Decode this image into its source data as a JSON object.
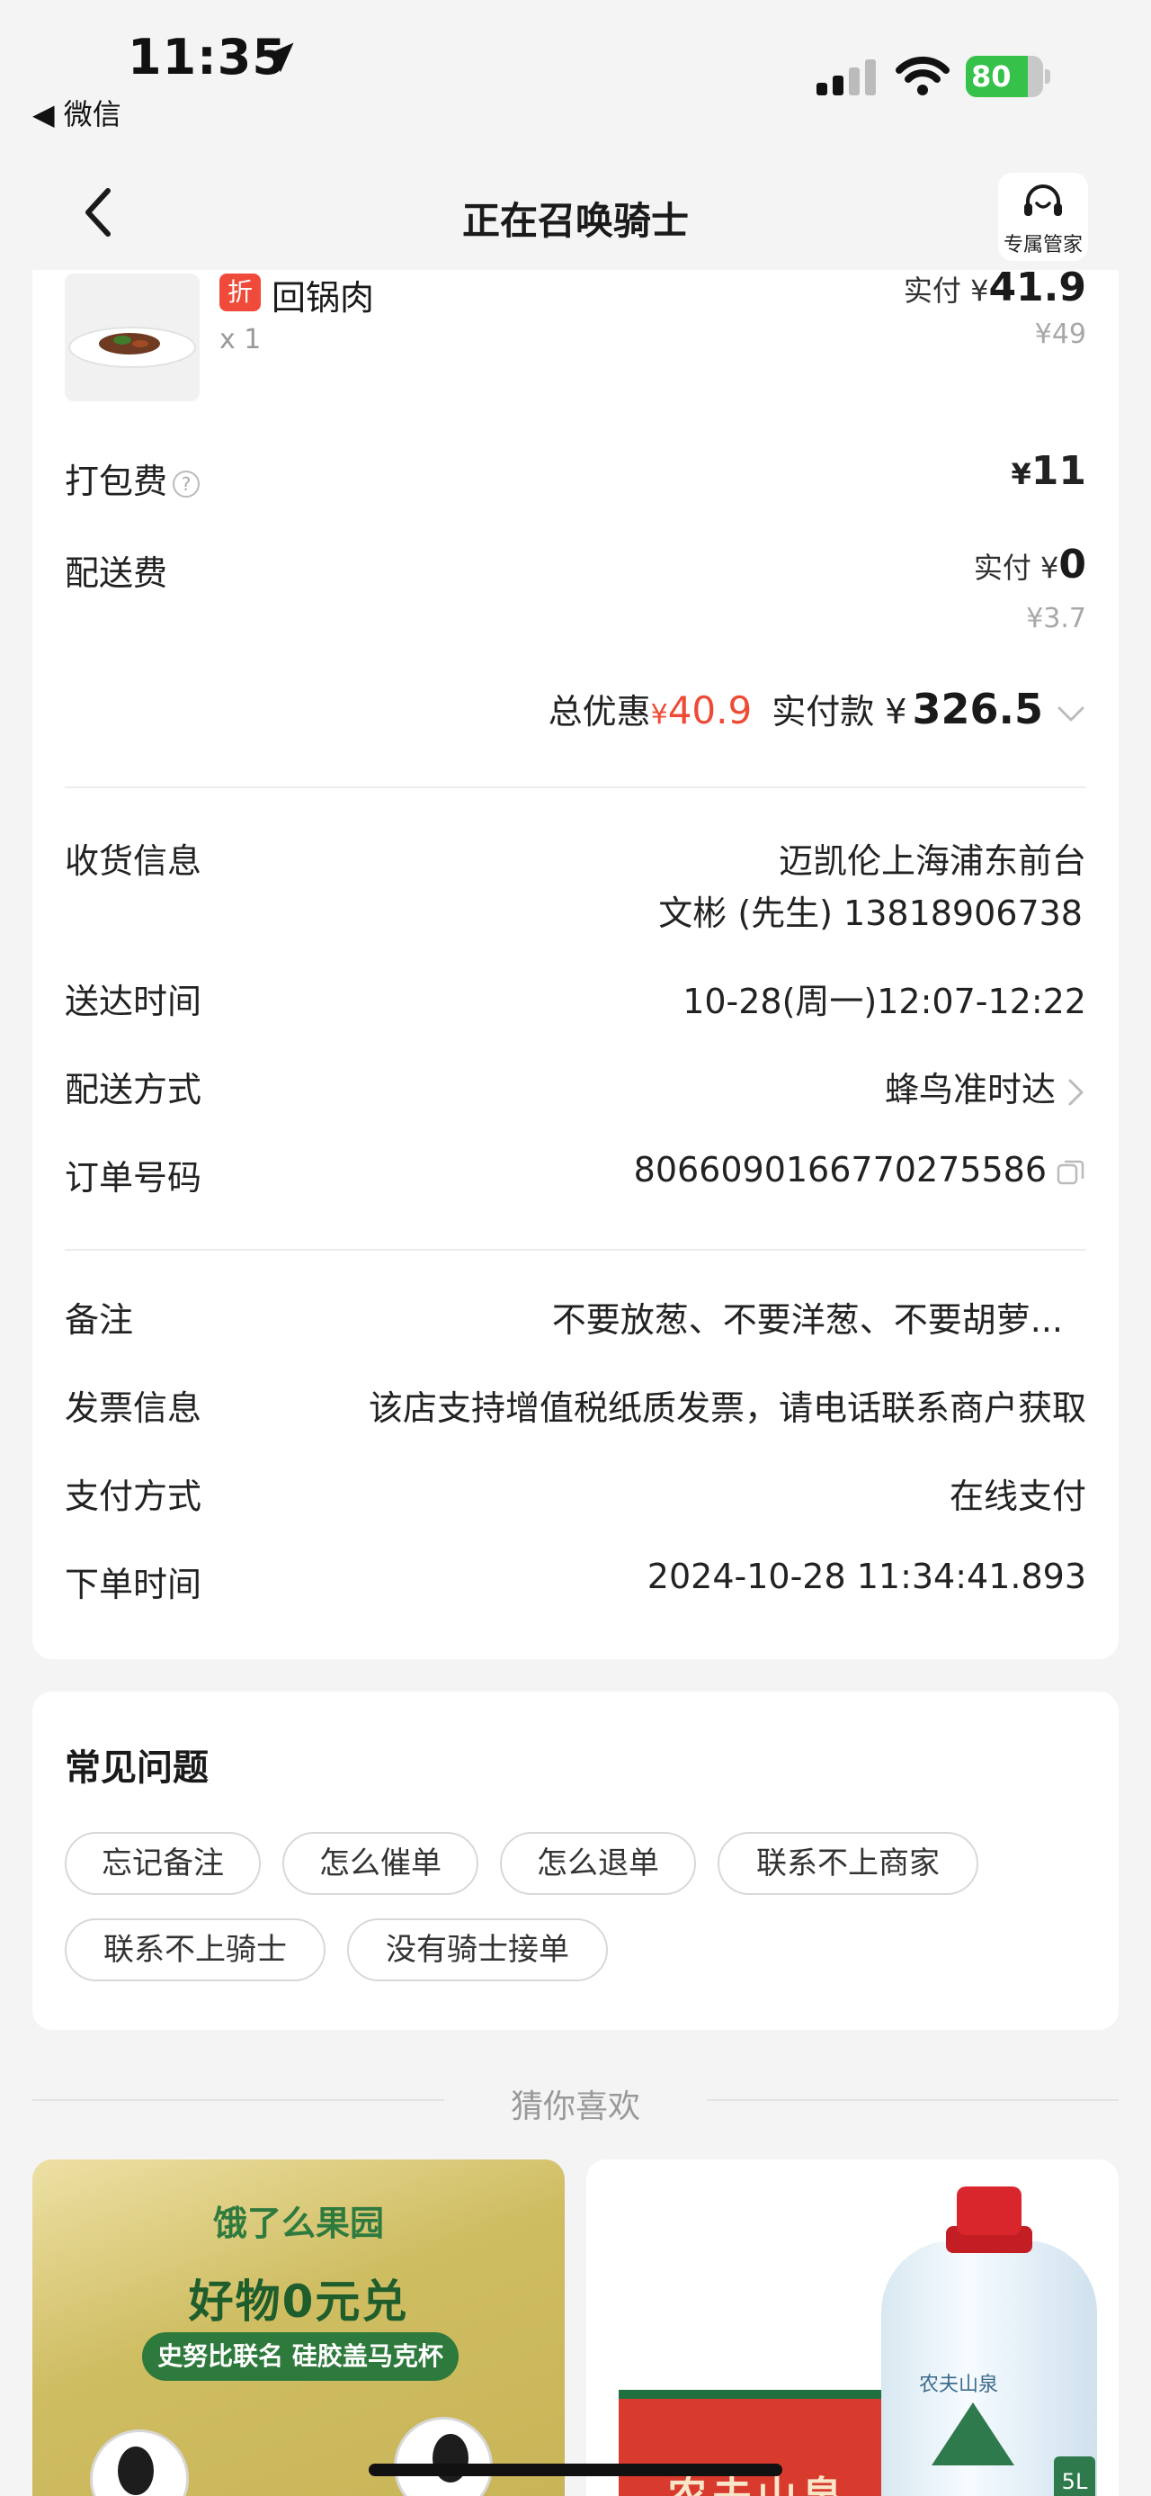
{
  "status_bar": {
    "time": "11:35",
    "back_app": "◀ 微信",
    "battery": "80",
    "battery_level": 0.8,
    "battery_color": "#36c24a"
  },
  "header": {
    "title": "正在召唤骑士",
    "agent_label": "专属管家"
  },
  "order_item": {
    "badge": "折",
    "name": "回锅肉",
    "qty": "x 1",
    "paid_label": "实付 ¥",
    "paid_value": "41.9",
    "original_price": "¥49"
  },
  "fees": {
    "packing_label": "打包费",
    "packing_info_icon": "?",
    "packing_currency": "¥",
    "packing_value": "11",
    "delivery_label": "配送费",
    "delivery_paid_label": "实付 ¥",
    "delivery_paid_value": "0",
    "delivery_original": "¥3.7"
  },
  "totals": {
    "discount_label": "总优惠",
    "discount_currency": "¥",
    "discount_value": "40.9",
    "pay_label": "实付款 ¥",
    "pay_value": "326.5",
    "discount_color": "#ee4a35"
  },
  "details": {
    "receiver_label": "收货信息",
    "receiver_address": "迈凯伦上海浦东前台",
    "receiver_contact": "文彬 (先生) 13818906738",
    "delivery_time_label": "送达时间",
    "delivery_time_value": "10-28(周一)12:07-12:22",
    "delivery_method_label": "配送方式",
    "delivery_method_value": "蜂鸟准时达",
    "order_no_label": "订单号码",
    "order_no_value": "8066090166770275586",
    "remark_label": "备注",
    "remark_value": "不要放葱、不要洋葱、不要胡萝...",
    "invoice_label": "发票信息",
    "invoice_value": "该店支持增值税纸质发票，请电话联系商户获取",
    "payment_label": "支付方式",
    "payment_value": "在线支付",
    "order_time_label": "下单时间",
    "order_time_value": "2024-10-28 11:34:41.893"
  },
  "faq": {
    "title": "常见问题",
    "chips": [
      "忘记备注",
      "怎么催单",
      "怎么退单",
      "联系不上商家",
      "联系不上骑士",
      "没有骑士接单"
    ]
  },
  "recommend": {
    "title": "猜你喜欢",
    "card1_brand": "饿了么果园",
    "card1_headline": "好物0元兑",
    "card1_subtitle": "史努比联名 硅胶盖马克杯",
    "card2_box_text": "农夫山泉",
    "card2_bottle_label": "农夫山泉",
    "card2_size": "5L"
  }
}
